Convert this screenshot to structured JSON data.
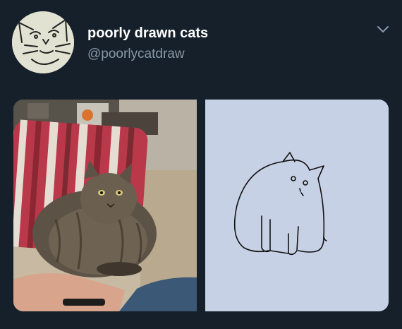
{
  "tweet": {
    "display_name": "poorly drawn cats",
    "handle": "@poorlycatdraw",
    "menu_icon": "chevron-down-icon",
    "avatar_icon": "cat-sketch-avatar"
  },
  "media": {
    "photo_subject": "cat-photo",
    "drawing_subject": "cat-drawing"
  },
  "colors": {
    "background": "#15202b",
    "name": "#ffffff",
    "handle": "#8899a6"
  }
}
